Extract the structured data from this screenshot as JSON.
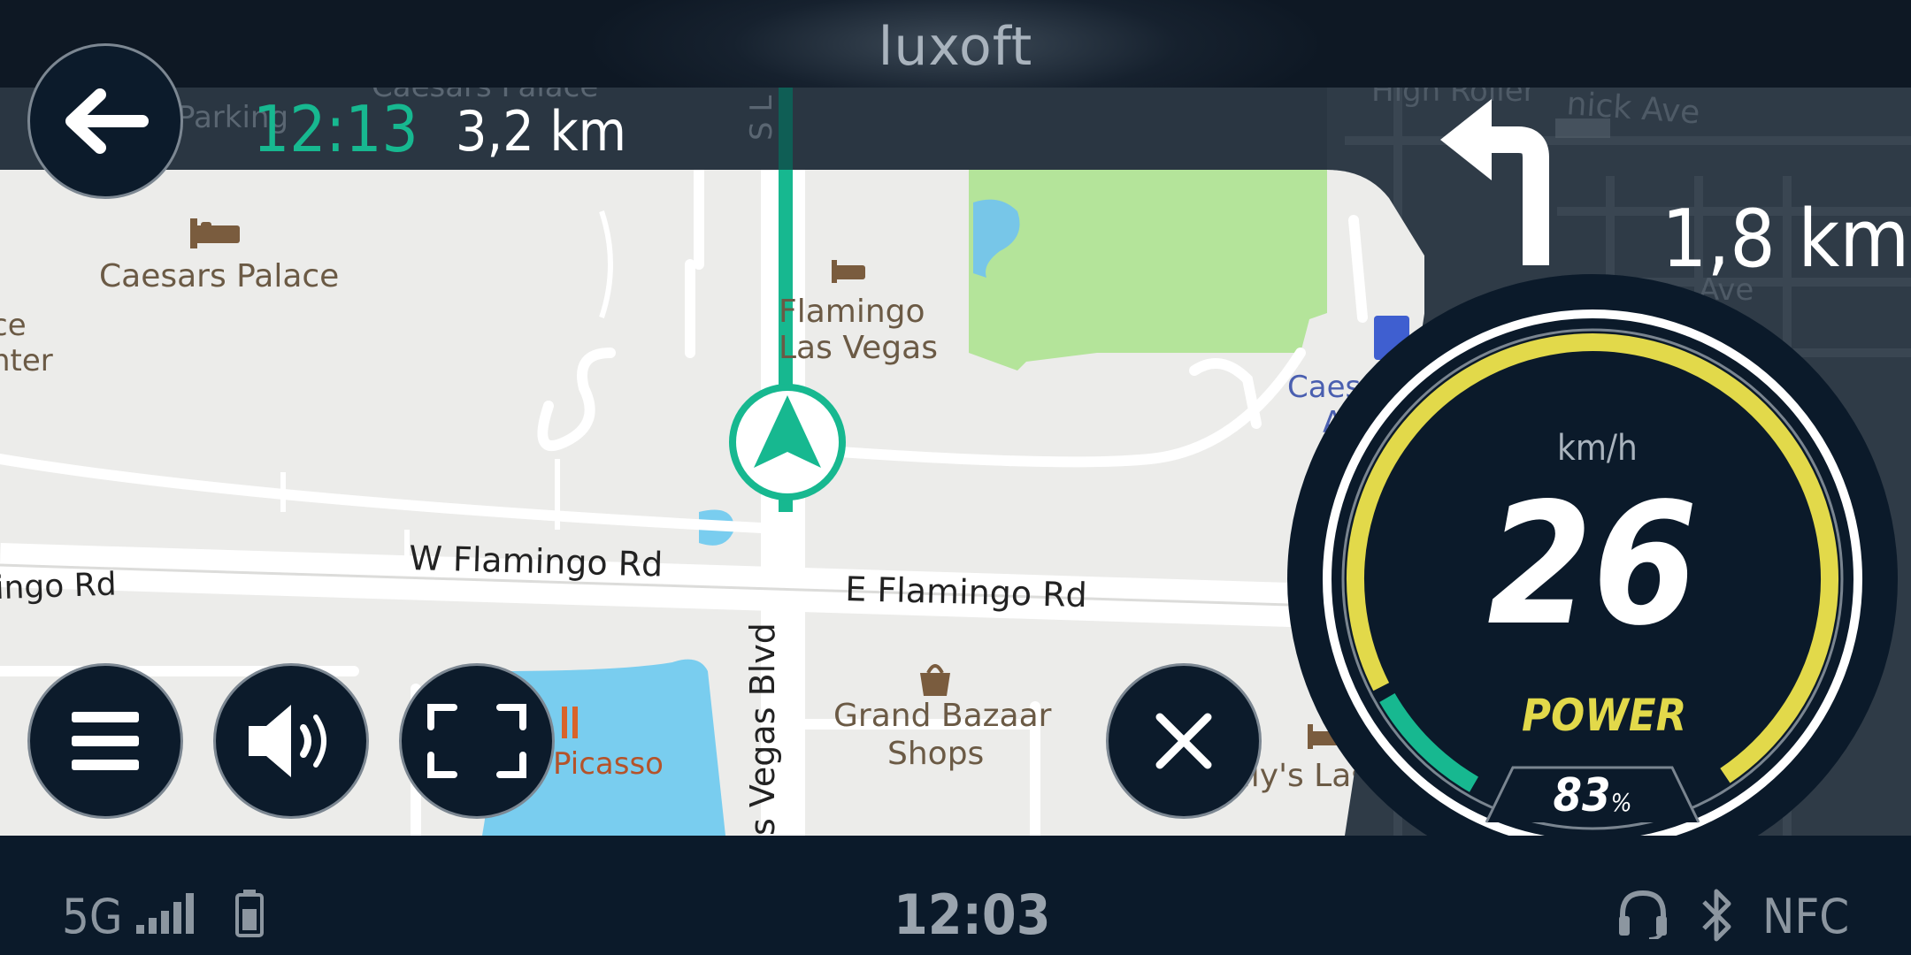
{
  "brand": "luxoft",
  "trip": {
    "eta_time": "12:13",
    "remaining_distance": "3,2 km"
  },
  "maneuver": {
    "icon": "turn-left-arrow-icon",
    "distance": "1,8 km"
  },
  "map_labels": {
    "caesars_palace": "Caesars Palace",
    "caesars_palace_faded": "Caesars Palace",
    "parking": "Parking",
    "forum_shops_1": "ce",
    "forum_shops_2": "nter",
    "high_roller": "High Roller",
    "linq": "nick Ave",
    "ave": "Ave",
    "flamingo_1": "Flamingo",
    "flamingo_2": "Las Vegas",
    "w_flamingo": "W Flamingo Rd",
    "e_flamingo": "E Flamingo Rd",
    "w_flamingo_left": "ingo Rd",
    "las_vegas_blvd": "s Vegas Blvd",
    "s_lv": "S L",
    "grand_bazaar_1": "Grand Bazaar",
    "grand_bazaar_2": "Shops",
    "picasso": "Picasso",
    "ballys": "Bally's Las",
    "caesars_blue": "Caes",
    "caesars_blue_2": "A"
  },
  "speedometer": {
    "unit": "km/h",
    "speed": "26",
    "mode": "POWER",
    "battery_percent": "83",
    "battery_unit": "%",
    "battery_level": 0.83,
    "arc_color": "#e2d94a",
    "regen_color": "#17b890"
  },
  "controls": {
    "back_icon": "arrow-left-icon",
    "menu_icon": "menu-icon",
    "volume_icon": "volume-icon",
    "fullscreen_icon": "fullscreen-icon",
    "close_icon": "close-icon"
  },
  "status_bar": {
    "network": "5G",
    "clock": "12:03",
    "nfc": "NFC",
    "signal_icon": "signal-bars-icon",
    "battery_icon": "battery-icon",
    "headset_icon": "headset-icon",
    "bluetooth_icon": "bluetooth-icon"
  },
  "colors": {
    "accent": "#17b890",
    "speed_arc": "#e2d94a",
    "background": "#0b1a2a"
  }
}
